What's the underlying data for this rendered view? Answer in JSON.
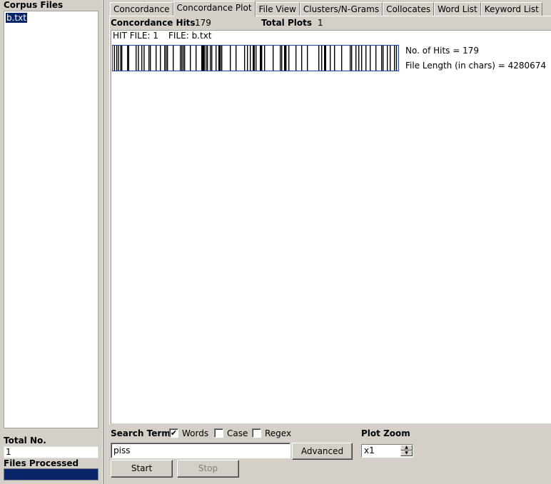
{
  "sidebar": {
    "title": "Corpus Files",
    "files": [
      "b.txt"
    ],
    "total_label": "Total No.",
    "total_value": "1",
    "files_processed_label": "Files Processed"
  },
  "tabs": [
    {
      "label": "Concordance",
      "active": false
    },
    {
      "label": "Concordance Plot",
      "active": true
    },
    {
      "label": "File View",
      "active": false
    },
    {
      "label": "Clusters/N-Grams",
      "active": false
    },
    {
      "label": "Collocates",
      "active": false
    },
    {
      "label": "Word List",
      "active": false
    },
    {
      "label": "Keyword List",
      "active": false
    }
  ],
  "summary": {
    "hits_label": "Concordance Hits",
    "hits_value": "179",
    "plots_label": "Total Plots",
    "plots_value": "1"
  },
  "plot": {
    "hit_file": "HIT FILE: 1",
    "file": "FILE: b.txt",
    "hits_text": "No. of Hits = 179",
    "length_text": "File Length (in chars) = 4280674",
    "hit_positions": [
      0.004,
      0.012,
      0.018,
      0.026,
      0.03,
      0.05,
      0.054,
      0.08,
      0.088,
      0.1,
      0.108,
      0.125,
      0.13,
      0.15,
      0.165,
      0.18,
      0.185,
      0.19,
      0.21,
      0.235,
      0.24,
      0.245,
      0.25,
      0.27,
      0.29,
      0.31,
      0.315,
      0.325,
      0.33,
      0.34,
      0.345,
      0.36,
      0.37,
      0.375,
      0.38,
      0.41,
      0.43,
      0.46,
      0.47,
      0.48,
      0.49,
      0.5,
      0.515,
      0.52,
      0.53,
      0.56,
      0.585,
      0.59,
      0.6,
      0.605,
      0.615,
      0.64,
      0.66,
      0.68,
      0.72,
      0.73,
      0.74,
      0.76,
      0.775,
      0.8,
      0.83,
      0.835,
      0.85,
      0.86,
      0.87,
      0.885,
      0.9,
      0.92,
      0.94,
      0.945,
      0.96,
      0.97,
      0.985,
      0.992
    ],
    "thick_positions": [
      0.31,
      0.315,
      0.37,
      0.49,
      0.515,
      0.6,
      0.74
    ]
  },
  "search": {
    "label": "Search Term",
    "words_label": "Words",
    "words_checked": true,
    "case_label": "Case",
    "case_checked": false,
    "regex_label": "Regex",
    "regex_checked": false,
    "term": "piss",
    "advanced_label": "Advanced",
    "start_label": "Start",
    "stop_label": "Stop"
  },
  "zoom": {
    "label": "Plot Zoom",
    "value": "x1"
  },
  "colors": {
    "selection": "#0a246a",
    "plot_border": "#1f3fa0"
  }
}
